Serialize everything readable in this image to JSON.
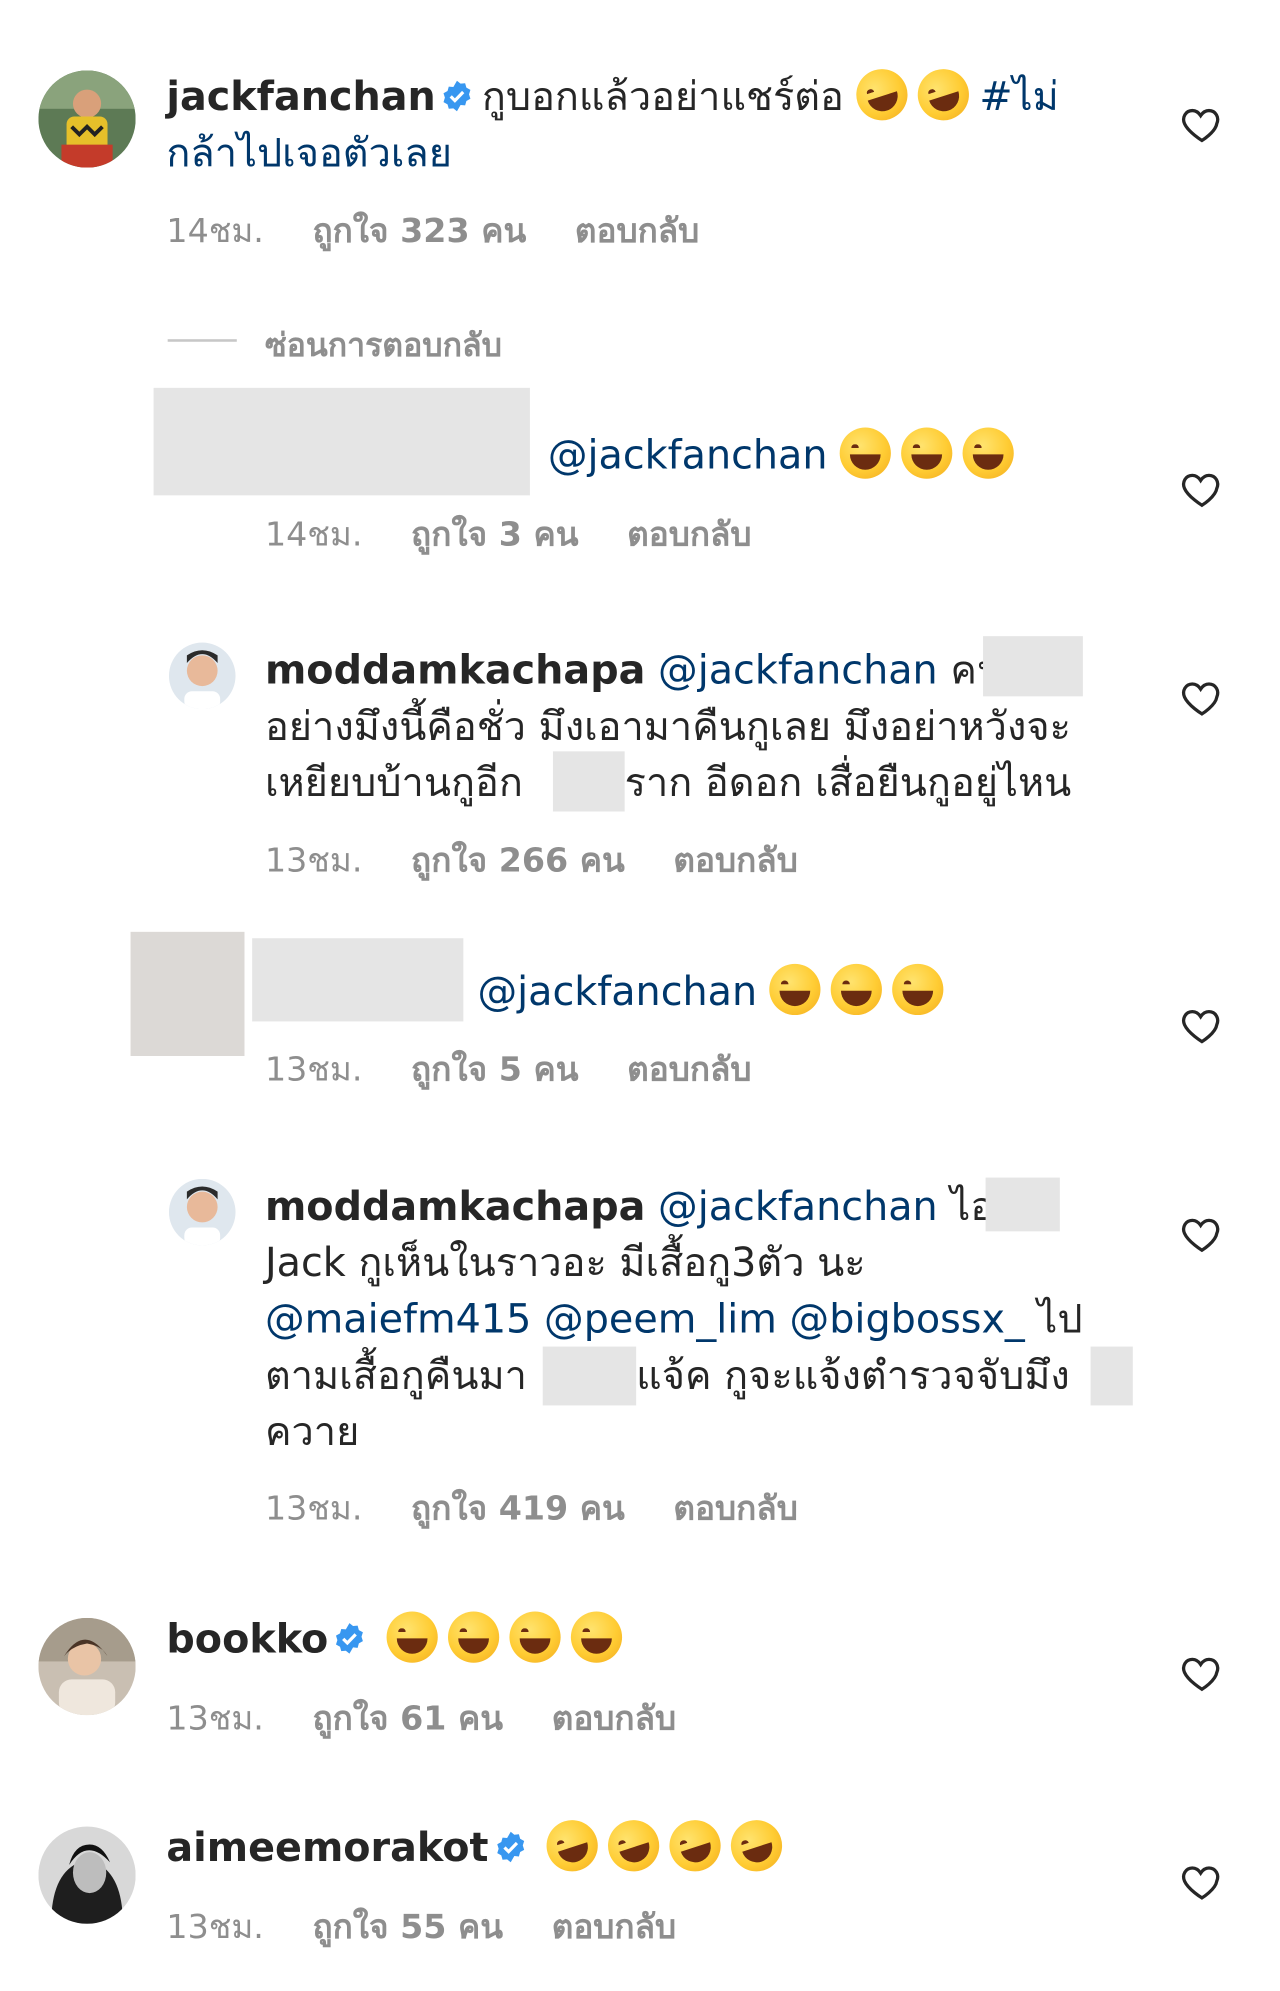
{
  "colors": {
    "text": "#262626",
    "meta": "#8e8e8e",
    "mention": "#00376b",
    "verified": "#3897f0",
    "censor": "#e5e5e5"
  },
  "hide_replies_label": "ซ่อนการตอบกลับ",
  "comments": [
    {
      "username": "jackfanchan",
      "verified": true,
      "line1": "กูบอกแล้วอย่าแชร์ต่อ",
      "hashtag1": "#ไม่",
      "hashtag2": "กล้าไปเจอตัวเลย",
      "emojis": [
        "rofl-emoji",
        "rofl-emoji"
      ],
      "time": "14ชม.",
      "likes": "ถูกใจ 323 คน",
      "reply": "ตอบกลับ"
    },
    {
      "mention": "@jackfanchan",
      "emojis": [
        "joy-emoji",
        "joy-emoji",
        "joy-emoji"
      ],
      "time": "14ชม.",
      "likes": "ถูกใจ 3 คน",
      "reply": "ตอบกลับ"
    },
    {
      "username": "moddamkachapa",
      "mention": "@jackfanchan",
      "line1_tail": "คน",
      "line2": "อย่างมึงนี้คือชั่ว มึงเอามาคืนกูเลย มึงอย่าหวังจะ",
      "line3a": "เหยียบบ้านกูอีก",
      "line3b": "ราก อีดอก เสื่อยืนกูอยู่ไหน",
      "time": "13ชม.",
      "likes": "ถูกใจ 266 คน",
      "reply": "ตอบกลับ"
    },
    {
      "mention": "@jackfanchan",
      "emojis": [
        "joy-emoji",
        "joy-emoji",
        "joy-emoji"
      ],
      "time": "13ชม.",
      "likes": "ถูกใจ 5 คน",
      "reply": "ตอบกลับ"
    },
    {
      "username": "moddamkachapa",
      "mention": "@jackfanchan",
      "line1_tail": "ไอเ",
      "line2": "Jack กูเห็นในราวอะ มีเสื้อกู3ตัว นะ",
      "mention_a": "@maiefm415",
      "mention_b": "@peem_lim",
      "mention_c": "@bigbossx_",
      "line3_tail": "ไป",
      "line4a": "ตามเสื้อกูคืนมา",
      "line4b": "แจ้ค กูจะแจ้งตำรวจจับมึง",
      "line5": "ควาย",
      "time": "13ชม.",
      "likes": "ถูกใจ 419 คน",
      "reply": "ตอบกลับ"
    },
    {
      "username": "bookko",
      "verified": true,
      "emojis": [
        "joy-emoji",
        "joy-emoji",
        "joy-emoji",
        "joy-emoji"
      ],
      "time": "13ชม.",
      "likes": "ถูกใจ 61 คน",
      "reply": "ตอบกลับ"
    },
    {
      "username": "aimeemorakot",
      "verified": true,
      "emojis": [
        "rofl-emoji",
        "rofl-emoji",
        "rofl-emoji",
        "rofl-emoji"
      ],
      "time": "13ชม.",
      "likes": "ถูกใจ 55 คน",
      "reply": "ตอบกลับ"
    }
  ]
}
